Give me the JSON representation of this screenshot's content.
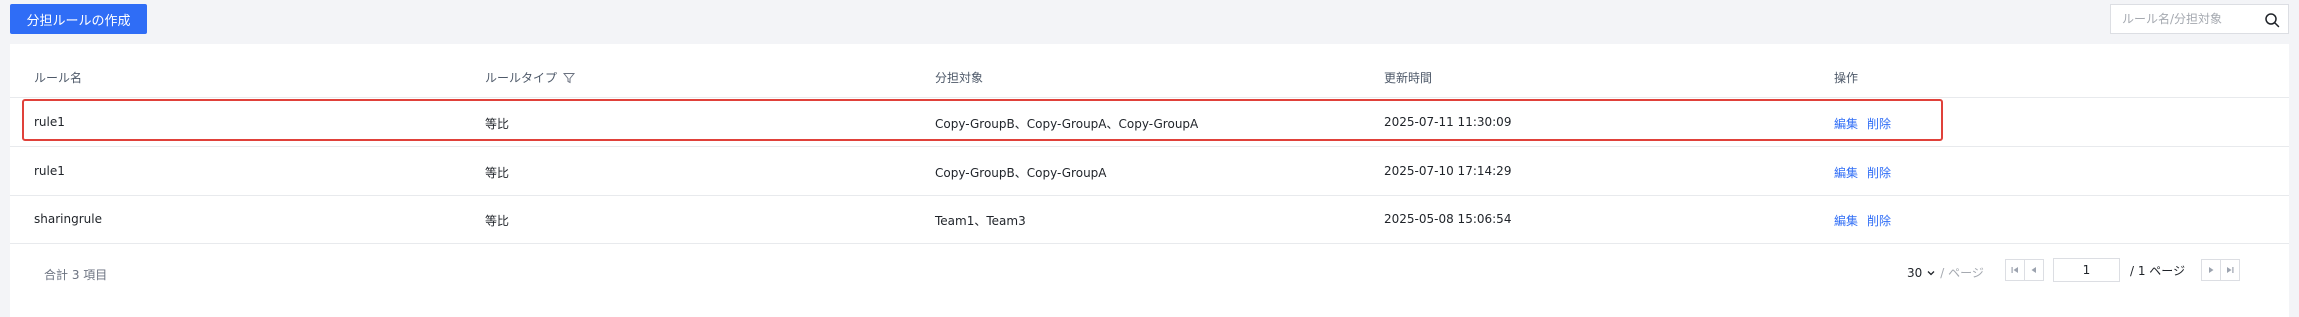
{
  "toolbar": {
    "create_label": "分担ルールの作成"
  },
  "search": {
    "placeholder": "ルール名/分担対象"
  },
  "table": {
    "headers": [
      "ルール名",
      "ルールタイプ",
      "分担対象",
      "更新時間",
      "操作"
    ],
    "rows": [
      {
        "name": "rule1",
        "type": "等比",
        "targets": "Copy-GroupB、Copy-GroupA、Copy-GroupA",
        "updated": "2025-07-11 11:30:09",
        "edit": "編集",
        "delete": "削除"
      },
      {
        "name": "rule1",
        "type": "等比",
        "targets": "Copy-GroupB、Copy-GroupA",
        "updated": "2025-07-10 17:14:29",
        "edit": "編集",
        "delete": "削除"
      },
      {
        "name": "sharingrule",
        "type": "等比",
        "targets": "Team1、Team3",
        "updated": "2025-05-08 15:06:54",
        "edit": "編集",
        "delete": "削除"
      }
    ]
  },
  "footer": {
    "total": "合計 3 項目",
    "page_size": "30",
    "page_size_unit": "/ ページ",
    "current_page": "1",
    "page_total": "/ 1 ページ"
  },
  "colors": {
    "primary": "#2f6df6",
    "highlight": "#e0413a"
  },
  "icons": [
    "search-icon",
    "filter-icon",
    "chevron-down-icon",
    "first-page-icon",
    "prev-page-icon",
    "next-page-icon",
    "last-page-icon"
  ]
}
